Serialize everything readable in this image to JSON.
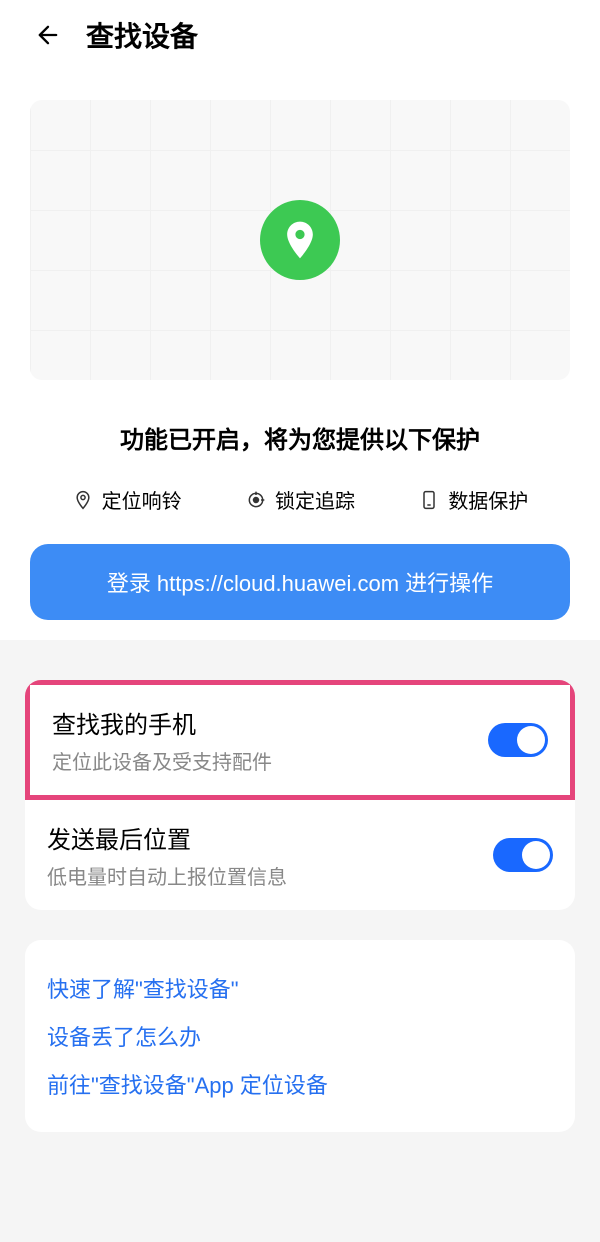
{
  "header": {
    "title": "查找设备"
  },
  "hero": {
    "status_text": "功能已开启，将为您提供以下保护",
    "features": [
      {
        "label": "定位响铃"
      },
      {
        "label": "锁定追踪"
      },
      {
        "label": "数据保护"
      }
    ],
    "login_button": "登录 https://cloud.huawei.com 进行操作"
  },
  "settings": [
    {
      "title": "查找我的手机",
      "subtitle": "定位此设备及受支持配件",
      "highlighted": true,
      "enabled": true
    },
    {
      "title": "发送最后位置",
      "subtitle": "低电量时自动上报位置信息",
      "highlighted": false,
      "enabled": true
    }
  ],
  "links": [
    "快速了解\"查找设备\"",
    "设备丢了怎么办",
    "前往\"查找设备\"App 定位设备"
  ]
}
